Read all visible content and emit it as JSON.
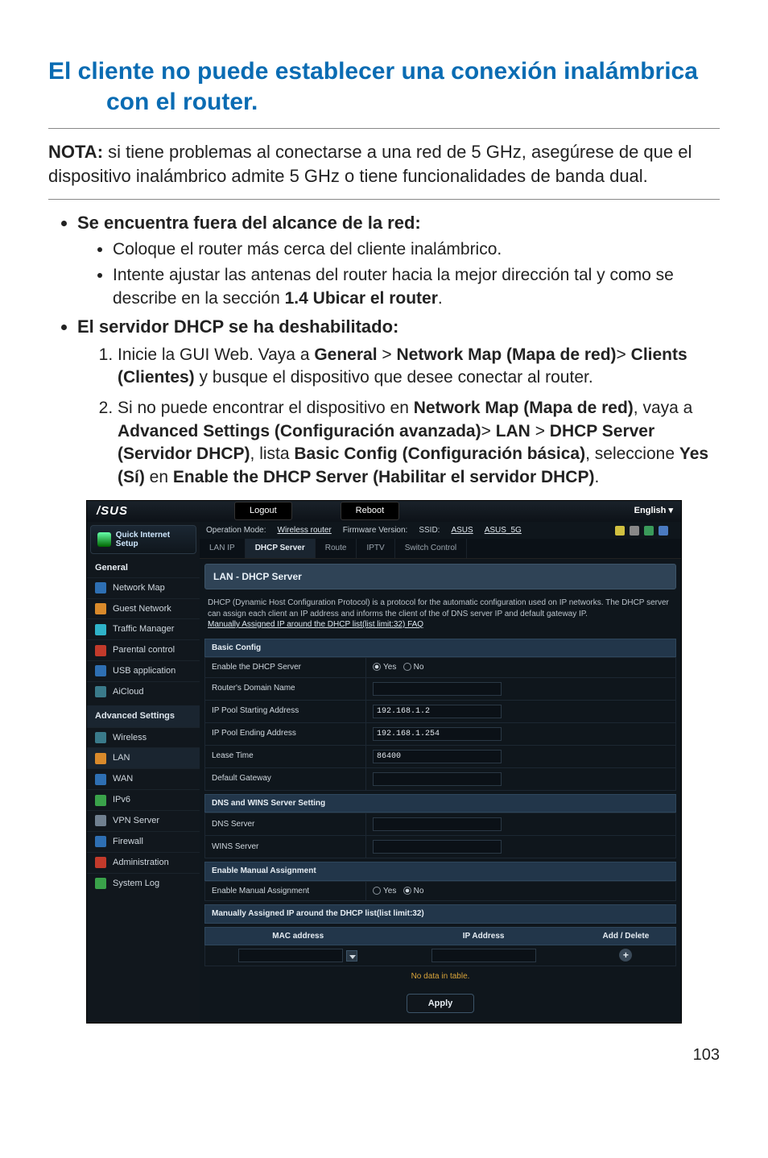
{
  "title_line1": "El cliente no puede establecer una conexión inalámbrica",
  "title_line2": "con el router.",
  "nota_label": "NOTA:",
  "nota_text": " si tiene problemas al conectarse a una red de 5 GHz, asegúrese de que el dispositivo inalámbrico admite 5 GHz o tiene funcionalidades de banda dual.",
  "bullets": {
    "b1": "Se encuentra fuera del alcance de la red:",
    "b1_s1": "Coloque el router más cerca del cliente inalámbrico.",
    "b1_s2a": "Intente ajustar las antenas del router hacia la mejor dirección tal y como se describe en la sección ",
    "b1_s2b": "1.4 Ubicar el router",
    "b1_s2c": ".",
    "b2": "El servidor DHCP se ha deshabilitado:",
    "b2_n1a": "Inicie la GUI Web. Vaya a ",
    "b2_n1b": "General",
    "b2_n1c": " > ",
    "b2_n1d": "Network Map (Mapa de red)",
    "b2_n1e": "> ",
    "b2_n1f": "Clients (Clientes)",
    "b2_n1g": " y busque el dispositivo que desee conectar al router.",
    "b2_n2a": "Si no puede encontrar el dispositivo en ",
    "b2_n2b": "Network Map (Mapa de red)",
    "b2_n2c": ", vaya a ",
    "b2_n2d": "Advanced Settings (Configuración avanzada)",
    "b2_n2e": "> ",
    "b2_n2f": "LAN",
    "b2_n2g": " > ",
    "b2_n2h": "DHCP Server (Servidor DHCP)",
    "b2_n2i": ", lista ",
    "b2_n2j": "Basic Config (Configuración básica)",
    "b2_n2k": ", seleccione ",
    "b2_n2l": "Yes (Sí)",
    "b2_n2m": " en ",
    "b2_n2n": "Enable the DHCP Server (Habilitar el servidor DHCP)",
    "b2_n2o": "."
  },
  "shot": {
    "logo": "/SUS",
    "logout": "Logout",
    "reboot": "Reboot",
    "english": "English",
    "quick": "Quick Internet Setup",
    "opmode_lbl": "Operation Mode:",
    "opmode_val": "Wireless router",
    "fw_lbl": "Firmware Version:",
    "ssid_lbl": "SSID:",
    "ssid1": "ASUS",
    "ssid2": "ASUS_5G",
    "general": "General",
    "side": {
      "network_map": "Network Map",
      "guest": "Guest Network",
      "traffic": "Traffic Manager",
      "parental": "Parental control",
      "usb": "USB application",
      "aicloud": "AiCloud"
    },
    "advanced": "Advanced Settings",
    "adv": {
      "wireless": "Wireless",
      "lan": "LAN",
      "wan": "WAN",
      "ipv6": "IPv6",
      "vpn": "VPN Server",
      "firewall": "Firewall",
      "admin": "Administration",
      "syslog": "System Log"
    },
    "tabs": {
      "lanip": "LAN IP",
      "dhcp": "DHCP Server",
      "route": "Route",
      "iptv": "IPTV",
      "switch": "Switch Control"
    },
    "panel_title": "LAN - DHCP Server",
    "desc1": "DHCP (Dynamic Host Configuration Protocol) is a protocol for the automatic configuration used on IP networks. The DHCP server can assign each client an IP address and informs the client of the of DNS server IP and default gateway IP.",
    "desc_link": "Manually Assigned IP around the DHCP list(list limit:32) FAQ",
    "sec_basic": "Basic Config",
    "rows": {
      "enable": "Enable the DHCP Server",
      "domain": "Router's Domain Name",
      "start": "IP Pool Starting Address",
      "end": "IP Pool Ending Address",
      "lease": "Lease Time",
      "gateway": "Default Gateway"
    },
    "vals": {
      "start": "192.168.1.2",
      "end": "192.168.1.254",
      "lease": "86400"
    },
    "yes": "Yes",
    "no": "No",
    "sec_dns": "DNS and WINS Server Setting",
    "dns": "DNS Server",
    "wins": "WINS Server",
    "sec_manual": "Enable Manual Assignment",
    "manual_row": "Enable Manual Assignment",
    "sec_list": "Manually Assigned IP around the DHCP list(list limit:32)",
    "col_mac": "MAC address",
    "col_ip": "IP Address",
    "col_add": "Add / Delete",
    "nodata": "No data in table.",
    "apply": "Apply"
  },
  "page": "103"
}
